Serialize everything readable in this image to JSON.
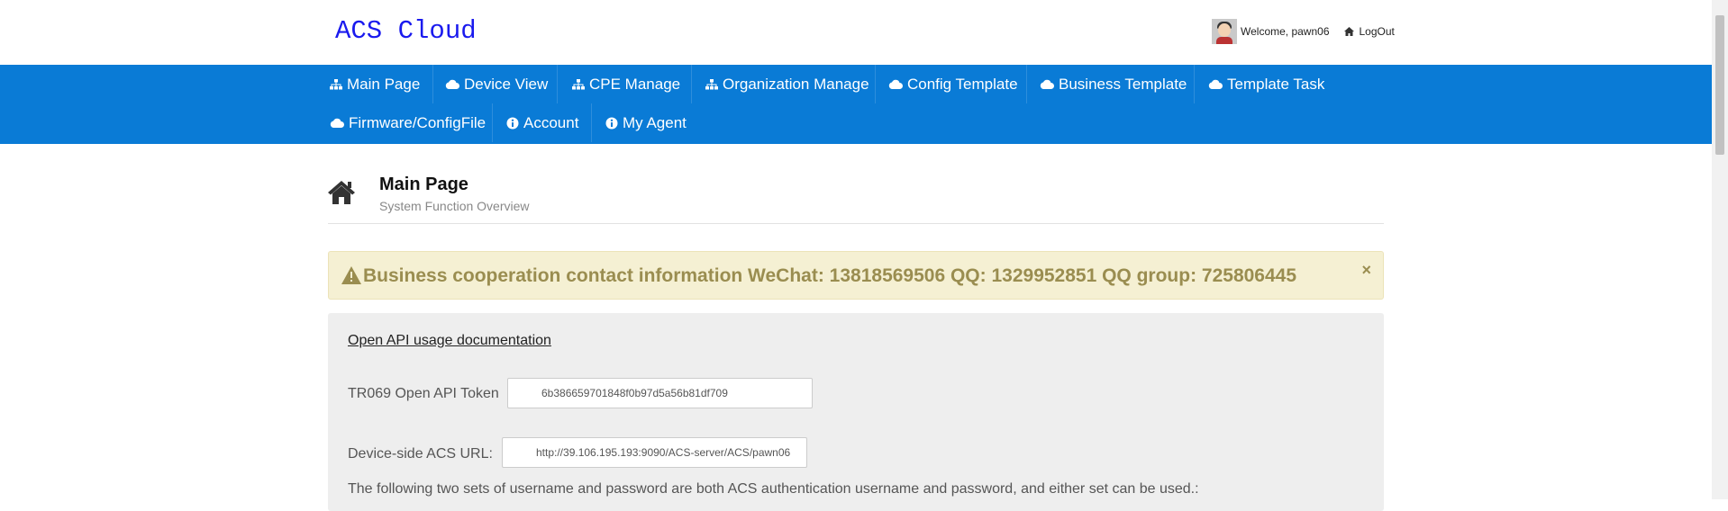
{
  "header": {
    "brand": "ACS Cloud",
    "welcome": "Welcome, pawn06",
    "logout": "LogOut"
  },
  "nav": {
    "row1": [
      {
        "label": "Main Page",
        "icon": "sitemap-icon"
      },
      {
        "label": "Device View",
        "icon": "cloud-icon"
      },
      {
        "label": "CPE Manage",
        "icon": "sitemap-icon"
      },
      {
        "label": "Organization Manage",
        "icon": "sitemap-icon"
      },
      {
        "label": "Config Template",
        "icon": "cloud-icon"
      },
      {
        "label": "Business Template",
        "icon": "cloud-icon"
      },
      {
        "label": "Template Task",
        "icon": "cloud-icon"
      }
    ],
    "row2": [
      {
        "label": "Firmware/ConfigFile",
        "icon": "cloud-icon"
      },
      {
        "label": "Account",
        "icon": "info-icon"
      },
      {
        "label": "My Agent",
        "icon": "info-icon"
      }
    ]
  },
  "page": {
    "title": "Main Page",
    "subtitle": "System Function Overview"
  },
  "alert": {
    "text": "Business cooperation contact information WeChat: 13818569506 QQ: 1329952851 QQ group: 725806445",
    "close": "×"
  },
  "panel": {
    "api_link": "Open API usage documentation",
    "token_label": "TR069 Open API Token",
    "token_value": "6b386659701848f0b97d5a56b81df709",
    "acs_label": "Device-side ACS URL:",
    "acs_value": "http://39.106.195.193:9090/ACS-server/ACS/pawn06",
    "note": "The following two sets of username and password are both ACS authentication username and password, and either set can be used.:"
  },
  "colors": {
    "navbar": "#0a7bd6",
    "brand": "#1a1aee",
    "alert_bg": "#f5f0d3",
    "alert_text": "#9a8d50"
  }
}
